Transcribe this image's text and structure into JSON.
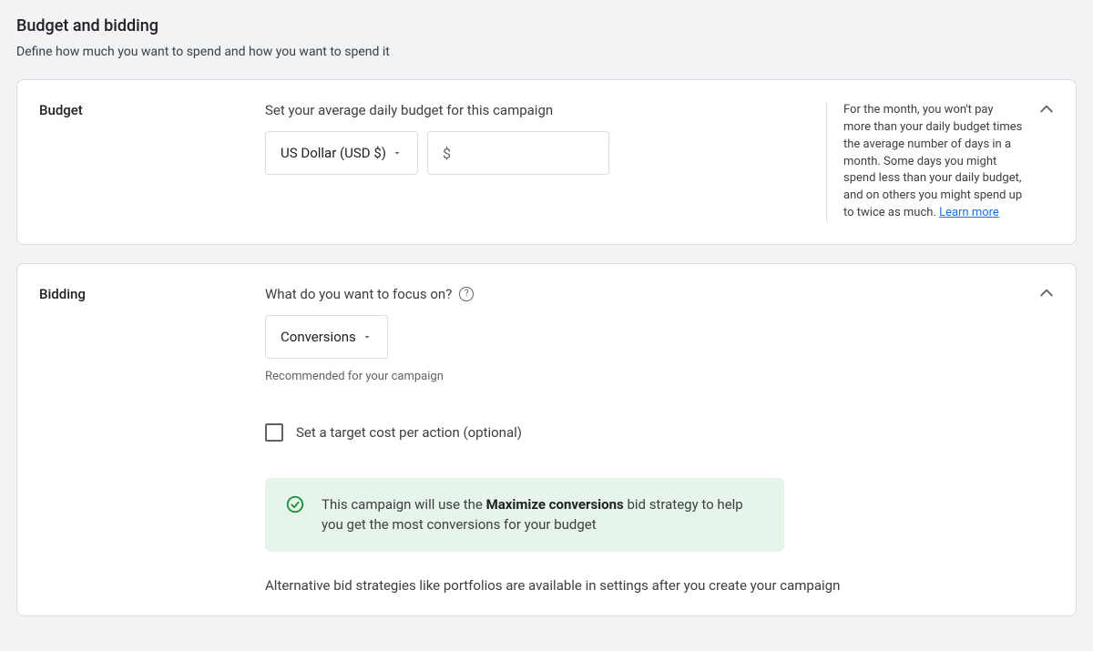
{
  "page": {
    "title": "Budget and bidding",
    "subtitle": "Define how much you want to spend and how you want to spend it"
  },
  "budget": {
    "section_label": "Budget",
    "field_label": "Set your average daily budget for this campaign",
    "currency_selected": "US Dollar (USD $)",
    "amount_prefix": "$",
    "amount_value": "",
    "aside_text": "For the month, you won't pay more than your daily budget times the average number of days in a month. Some days you might spend less than your daily budget, and on others you might spend up to twice as much. ",
    "learn_more": "Learn more"
  },
  "bidding": {
    "section_label": "Bidding",
    "focus_label": "What do you want to focus on?",
    "focus_selected": "Conversions",
    "recommended_text": "Recommended for your campaign",
    "cpa_checkbox_label": "Set a target cost per action (optional)",
    "banner_prefix": "This campaign will use the ",
    "banner_bold": "Maximize conversions",
    "banner_suffix": " bid strategy to help you get the most conversions for your budget",
    "alt_note": "Alternative bid strategies like portfolios are available in settings after you create your campaign"
  }
}
